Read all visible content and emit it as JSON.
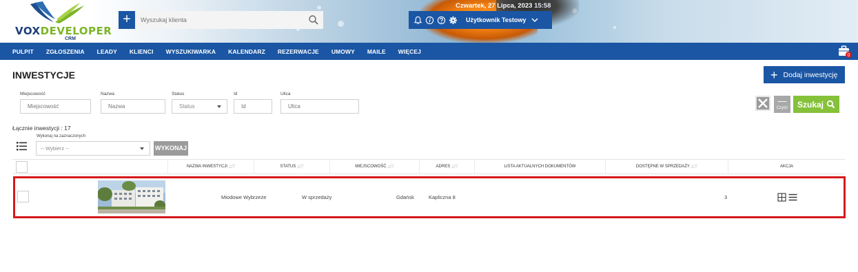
{
  "header": {
    "logo": {
      "brand_a": "VOX",
      "brand_b": "DEVELOPER",
      "sub": "CRM"
    },
    "search_placeholder": "Wyszukaj klienta",
    "date": "Czwartek, 27 Lipca, 2023",
    "time": "15:58",
    "user_name": "Użytkownik Testowy"
  },
  "nav": {
    "items": [
      "PULPIT",
      "ZGŁOSZENIA",
      "LEADY",
      "KLIENCI",
      "WYSZUKIWARKA",
      "KALENDARZ",
      "REZERWACJE",
      "UMOWY",
      "MAILE",
      "WIĘCEJ"
    ],
    "briefcase_badge": "0"
  },
  "page": {
    "title": "INWESTYCJE",
    "add_button": "Dodaj inwestycję"
  },
  "filters": {
    "miejscowosc": {
      "label": "Miejscowość",
      "placeholder": "Miejscowość"
    },
    "nazwa": {
      "label": "Nazwa",
      "placeholder": "Nazwa"
    },
    "status": {
      "label": "Status",
      "value": "Status"
    },
    "id": {
      "label": "Id",
      "placeholder": "Id"
    },
    "ulica": {
      "label": "Ulica",
      "placeholder": "Ulica"
    },
    "clear_label": "Czyść",
    "search_button": "Szukaj"
  },
  "summary": {
    "total": "Łącznie inwestycji : 17",
    "bulk_label": "Wykonaj na zaznaczonych",
    "bulk_select": "-- Wybierz --",
    "execute_button": "WYKONAJ"
  },
  "table": {
    "headers": {
      "name": "NAZWA INWESTYCJI",
      "status": "STATUS",
      "city": "MIEJSCOWOŚĆ",
      "address": "ADRES",
      "docs": "LISTA AKTUALNYCH DOKUMENTÓW",
      "available": "DOSTĘPNE W SPRZEDAŻY",
      "action": "AKCJA"
    },
    "sort_glyph": "△▽",
    "rows": [
      {
        "name": "Miodowe Wybrzeże",
        "status": "W sprzedaży",
        "city": "Gdańsk",
        "address": "Kapliczna 8",
        "available": "3"
      }
    ]
  },
  "colors": {
    "primary": "#1a56a4",
    "accent_green": "#86c13a",
    "highlight_red": "#d6181b"
  }
}
